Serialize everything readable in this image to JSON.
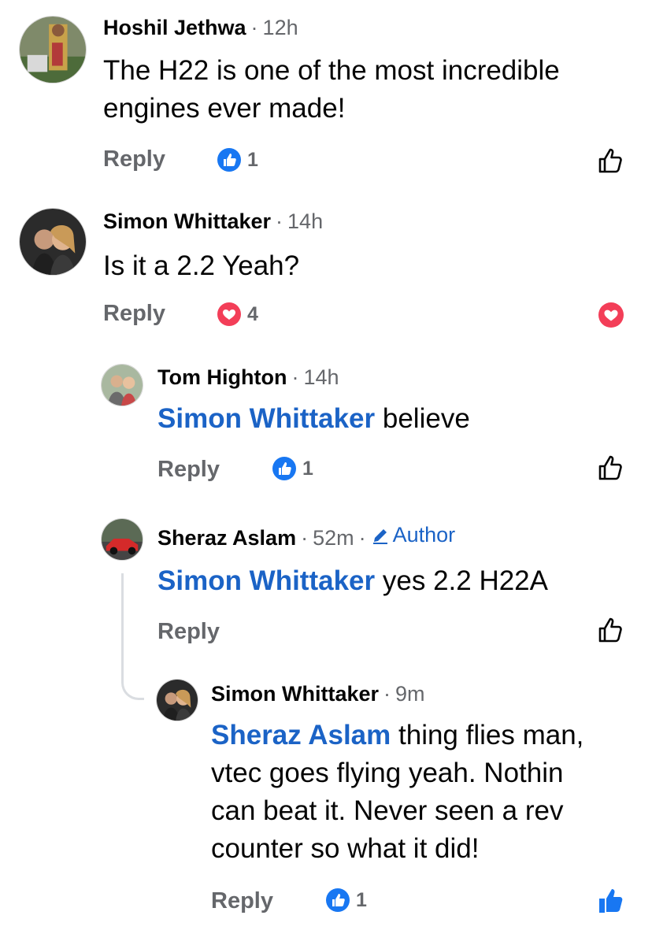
{
  "comments": [
    {
      "author": "Hoshil Jethwa",
      "time": "12h",
      "text": "The H22 is one of the most incredible engines ever made!",
      "reply_label": "Reply",
      "reaction": {
        "type": "like-icon",
        "count": "1"
      },
      "like_state": "unliked"
    },
    {
      "author": "Simon Whittaker",
      "time": "14h",
      "text": "Is it a 2.2 Yeah?",
      "reply_label": "Reply",
      "reaction": {
        "type": "heart-icon",
        "count": "4"
      },
      "like_state": "loved"
    },
    {
      "author": "Tom Highton",
      "time": "14h",
      "mention": "Simon Whittaker",
      "text": "believe",
      "reply_label": "Reply",
      "reaction": {
        "type": "like-icon",
        "count": "1"
      },
      "like_state": "unliked"
    },
    {
      "author": "Sheraz Aslam",
      "time": "52m",
      "badge": "Author",
      "mention": "Simon Whittaker",
      "text": "yes 2.2 H22A",
      "reply_label": "Reply",
      "like_state": "unliked"
    },
    {
      "author": "Simon Whittaker",
      "time": "9m",
      "mention": "Sheraz Aslam",
      "text_lines": [
        "thing flies man,",
        "vtec goes flying yeah. Nothin",
        "can beat it. Never seen a rev",
        "counter so what it did!"
      ],
      "reply_label": "Reply",
      "reaction": {
        "type": "like-icon",
        "count": "1"
      },
      "like_state": "liked"
    }
  ],
  "colors": {
    "link_blue": "#1b63c6",
    "like_blue": "#1877f2",
    "heart_red": "#f33e58",
    "meta_gray": "#65676b"
  }
}
